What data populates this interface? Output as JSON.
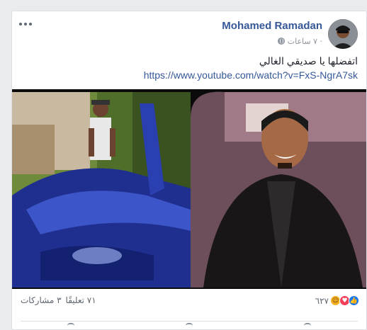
{
  "post": {
    "author": "Mohamed Ramadan",
    "timestamp": "٧ ساعات ·",
    "privacy_icon": "globe-icon",
    "text": "اتفضلها يا صديقي الغالي",
    "link": "https://www.youtube.com/watch?v=FxS-NgrA7sk"
  },
  "stats": {
    "reaction_count": "٦٢٧",
    "reactions": [
      "like-icon",
      "love-icon",
      "haha-icon"
    ],
    "comments": "٧١ تعليقًا",
    "shares": "٣ مشاركات"
  },
  "colors": {
    "author_link": "#365899",
    "like": "#1877f2",
    "love": "#f33e58",
    "haha": "#f7b125",
    "page_bg": "#e9ebee"
  }
}
